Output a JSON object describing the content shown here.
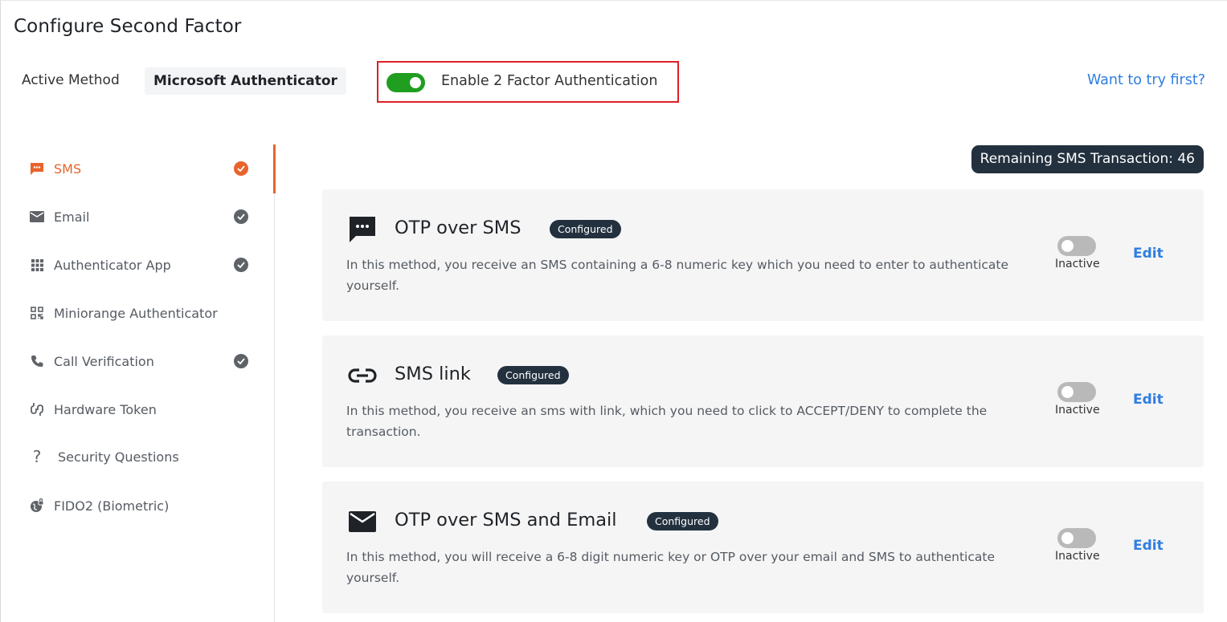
{
  "page": {
    "title": "Configure Second Factor"
  },
  "header": {
    "active_method_label": "Active Method",
    "active_method_value": "Microsoft Authenticator",
    "enable_2fa_label": "Enable 2 Factor Authentication",
    "enable_2fa_on": true,
    "try_first_link": "Want to try first?"
  },
  "sidebar": {
    "items": [
      {
        "label": "SMS",
        "icon": "sms-icon",
        "checked": true,
        "active": true
      },
      {
        "label": "Email",
        "icon": "email-icon",
        "checked": true,
        "active": false
      },
      {
        "label": "Authenticator App",
        "icon": "grid-icon",
        "checked": true,
        "active": false
      },
      {
        "label": "Miniorange Authenticator",
        "icon": "qr-icon",
        "checked": false,
        "active": false
      },
      {
        "label": "Call Verification",
        "icon": "phone-icon",
        "checked": true,
        "active": false
      },
      {
        "label": "Hardware Token",
        "icon": "token-icon",
        "checked": false,
        "active": false
      },
      {
        "label": "Security Questions",
        "icon": "question-icon",
        "checked": false,
        "active": false
      },
      {
        "label": "FIDO2 (Biometric)",
        "icon": "globe-lock-icon",
        "checked": false,
        "active": false
      }
    ]
  },
  "remaining": {
    "label": "Remaining SMS Transaction: 46"
  },
  "methods": [
    {
      "title": "OTP over SMS",
      "icon": "sms-bubble-icon",
      "badge": "Configured",
      "description": "In this method, you receive an SMS containing a 6-8 numeric key which you need to enter to authenticate yourself.",
      "status": "Inactive",
      "enabled": false,
      "edit_label": "Edit"
    },
    {
      "title": "SMS link",
      "icon": "link-icon",
      "badge": "Configured",
      "description": "In this method, you receive an sms with link, which you need to click to ACCEPT/DENY to complete the transaction.",
      "status": "Inactive",
      "enabled": false,
      "edit_label": "Edit"
    },
    {
      "title": "OTP over SMS and Email",
      "icon": "envelope-icon",
      "badge": "Configured",
      "description": "In this method, you will receive a 6-8 digit numeric key or OTP over your email and SMS to authenticate yourself.",
      "status": "Inactive",
      "enabled": false,
      "edit_label": "Edit"
    }
  ],
  "colors": {
    "accent": "#e8642c",
    "toggle_on": "#1f9e1f",
    "toggle_off": "#b9b9b9",
    "link": "#2f7ee0",
    "badge_bg": "#23313f",
    "highlight_border": "#e01f26"
  }
}
